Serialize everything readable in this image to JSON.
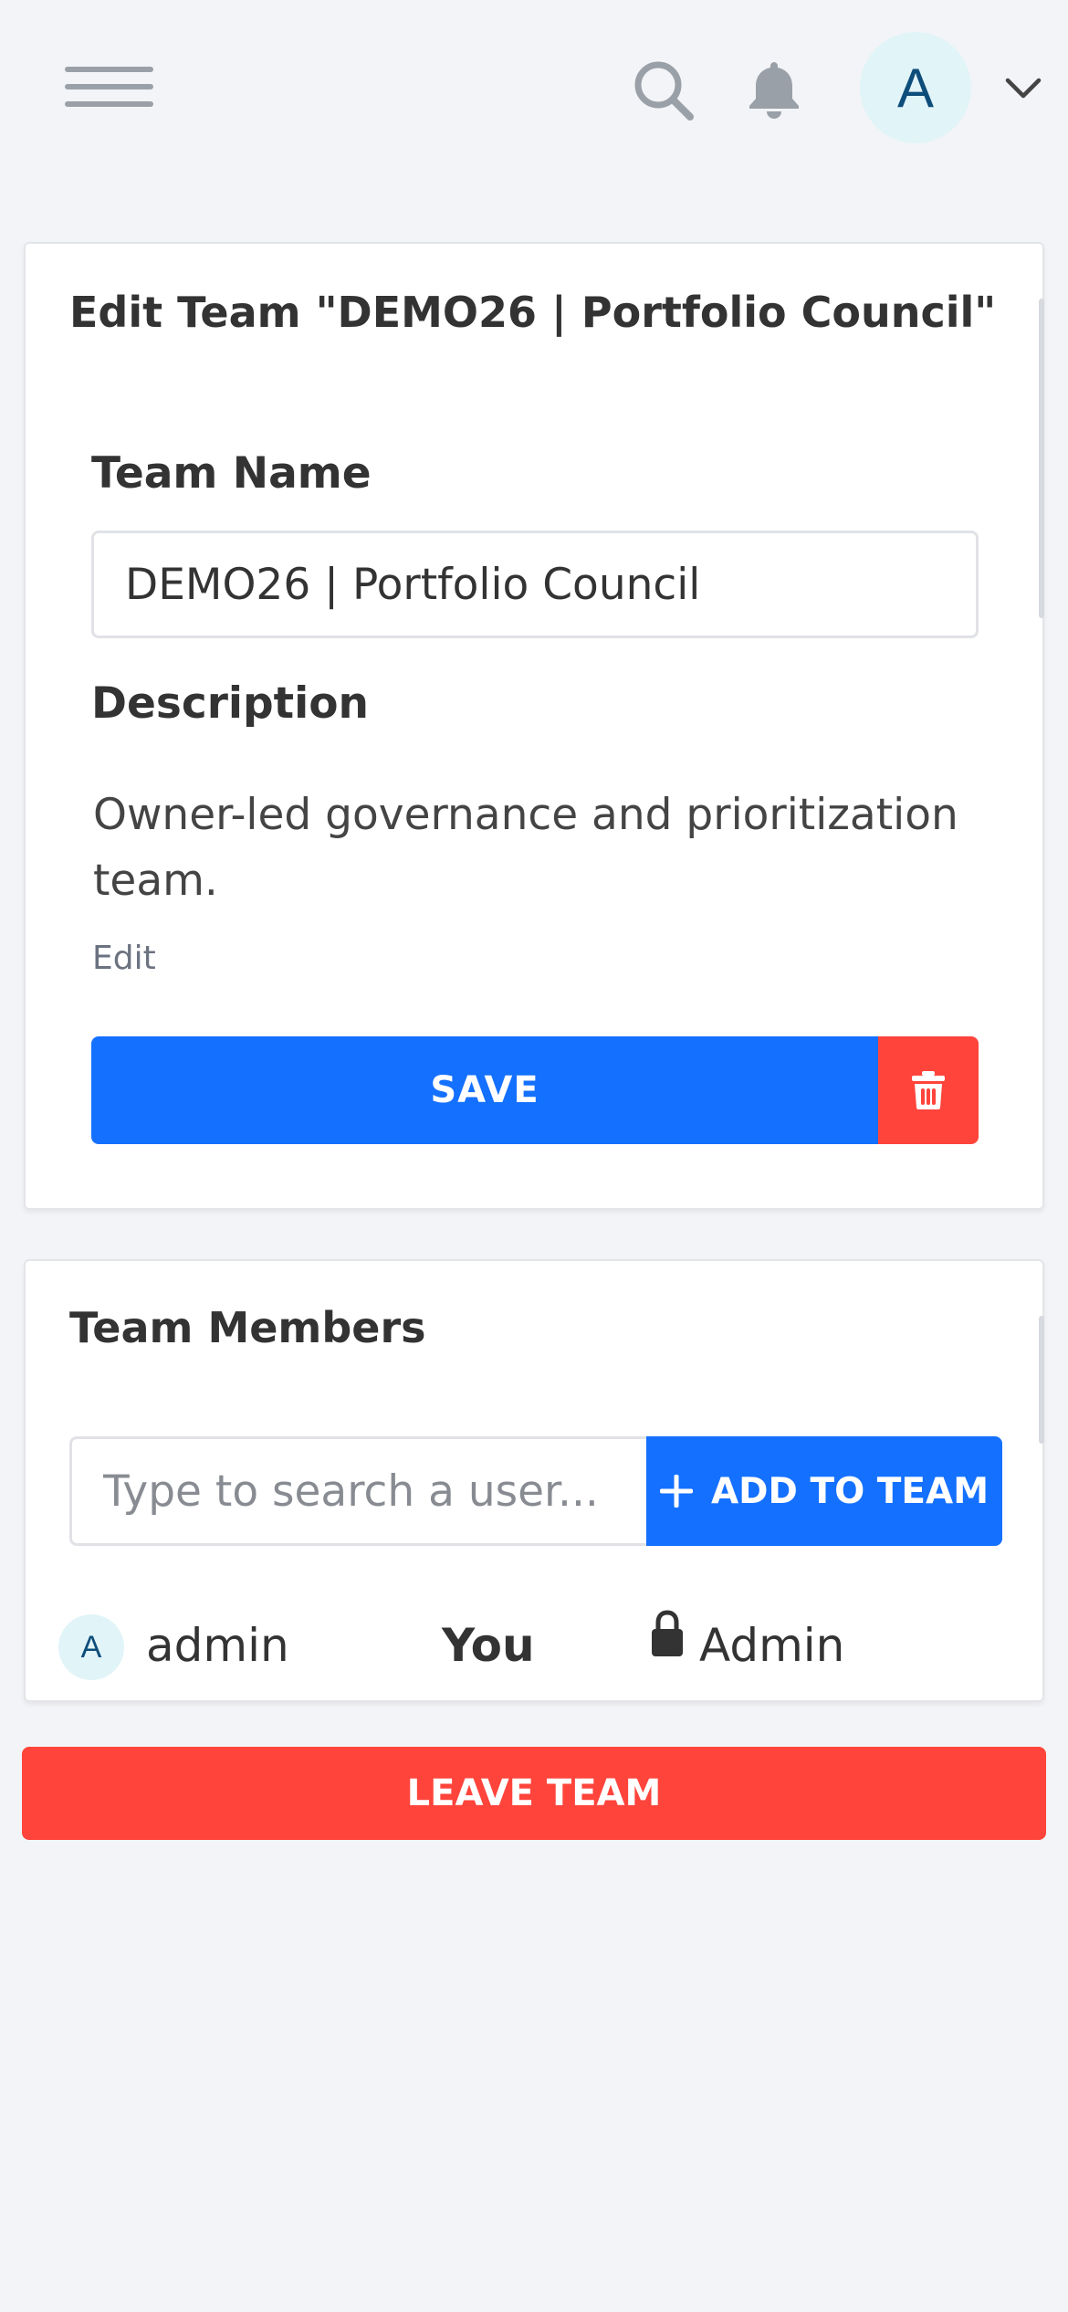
{
  "header": {
    "avatar_initial": "A",
    "icons": [
      "hamburger-menu-icon",
      "search-icon",
      "bell-icon",
      "chevron-down-icon"
    ]
  },
  "edit_team": {
    "title": "Edit Team \"DEMO26 | Portfolio Council\"",
    "team_name_label": "Team Name",
    "team_name_value": "DEMO26 | Portfolio Council",
    "description_label": "Description",
    "description_text": "Owner-led governance and prioritization team.",
    "edit_link": "Edit",
    "save_label": "SAVE"
  },
  "members": {
    "title": "Team Members",
    "search_placeholder": "Type to search a user...",
    "add_label": "ADD TO TEAM",
    "list": [
      {
        "initial": "A",
        "name": "admin",
        "you_label": "You",
        "role": "Admin"
      }
    ]
  },
  "leave_label": "LEAVE TEAM",
  "colors": {
    "primary": "#1470ff",
    "danger": "#ff443b",
    "background": "#f3f4f7",
    "avatar_bg": "#e1f4f8",
    "avatar_text": "#0d4d7a"
  }
}
